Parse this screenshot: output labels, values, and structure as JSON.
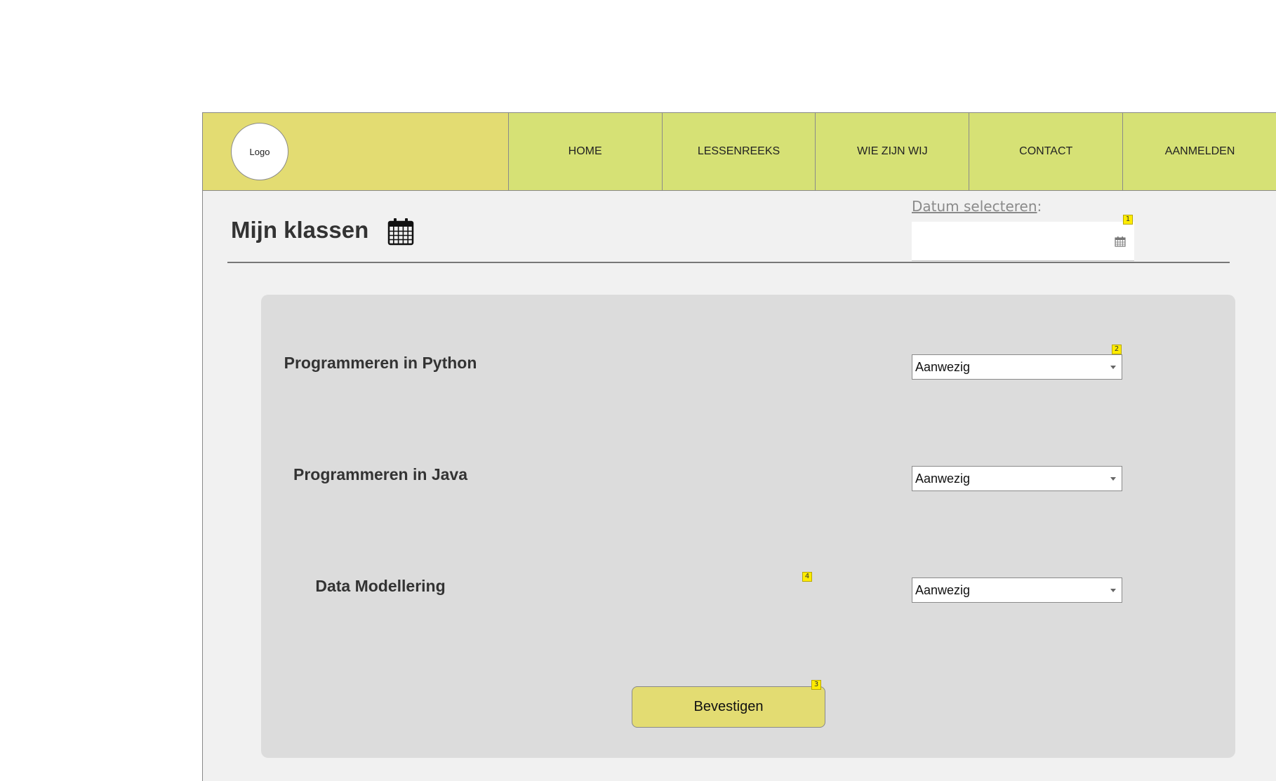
{
  "header": {
    "logo_text": "Logo",
    "nav": [
      {
        "label": "HOME"
      },
      {
        "label": "LESSENREEKS"
      },
      {
        "label": "WIE ZIJN WIJ"
      },
      {
        "label": "CONTACT"
      },
      {
        "label": "AANMELDEN"
      }
    ]
  },
  "main": {
    "title": "Mijn klassen",
    "title_icon": "calendar-icon",
    "date_label": "Datum selecteren",
    "date_label_suffix": ":",
    "date_value": "",
    "date_icon": "calendar-icon"
  },
  "courses": [
    {
      "name": "Programmeren in Python",
      "status": "Aanwezig"
    },
    {
      "name": "Programmeren in Java",
      "status": "Aanwezig"
    },
    {
      "name": "Data Modellering",
      "status": "Aanwezig"
    }
  ],
  "confirm_label": "Bevestigen",
  "annotations": [
    "1",
    "2",
    "3",
    "4"
  ],
  "colors": {
    "logo_bg": "#e3dc72",
    "nav_bg": "#d6e175",
    "page_bg": "#f1f1f1",
    "panel_bg": "#dcdcdc",
    "button_bg": "#e3dc72",
    "badge_bg": "#ffec00"
  }
}
